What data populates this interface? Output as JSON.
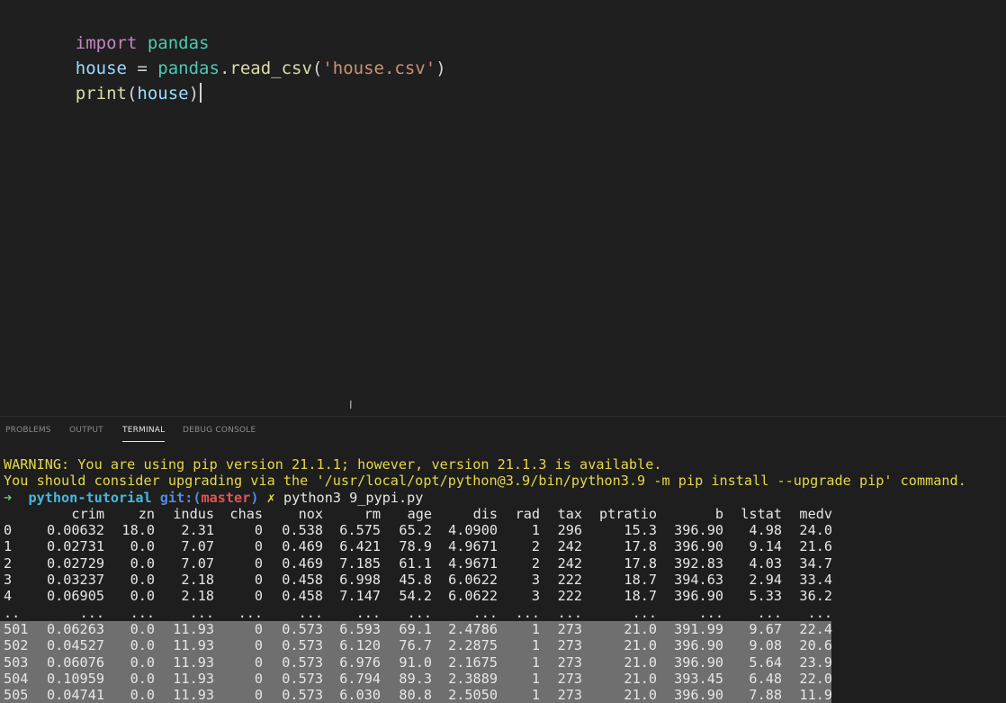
{
  "editor": {
    "line1": {
      "kw": "import",
      "mod": "pandas"
    },
    "line2": {
      "var": "house",
      "eq": " = ",
      "mod": "pandas",
      "dot": ".",
      "fn": "read_csv",
      "open": "(",
      "str": "'house.csv'",
      "close": ")"
    },
    "line3": {
      "fn": "print",
      "open": "(",
      "var": "house",
      "close": ")"
    }
  },
  "panel": {
    "tabs": [
      {
        "label": "PROBLEMS"
      },
      {
        "label": "OUTPUT"
      },
      {
        "label": "TERMINAL"
      },
      {
        "label": "DEBUG CONSOLE"
      }
    ],
    "active_tab": "TERMINAL"
  },
  "terminal": {
    "warning1": "WARNING: You are using pip version 21.1.1; however, version 21.1.3 is available.",
    "warning2": "You should consider upgrading via the '/usr/local/opt/python@3.9/bin/python3.9 -m pip install --upgrade pip' command.",
    "prompt": {
      "arrow": "➜",
      "dir": "python-tutorial",
      "git": "git:(",
      "branch": "master",
      "git_close": ")",
      "x": "✗",
      "command": "python3 9_pypi.py"
    },
    "columns": [
      "crim",
      "zn",
      "indus",
      "chas",
      "nox",
      "rm",
      "age",
      "dis",
      "rad",
      "tax",
      "ptratio",
      "b",
      "lstat",
      "medv"
    ],
    "rows": [
      {
        "idx": "0",
        "cells": [
          "0.00632",
          "18.0",
          "2.31",
          "0",
          "0.538",
          "6.575",
          "65.2",
          "4.0900",
          "1",
          "296",
          "15.3",
          "396.90",
          "4.98",
          "24.0"
        ],
        "selected": false
      },
      {
        "idx": "1",
        "cells": [
          "0.02731",
          "0.0",
          "7.07",
          "0",
          "0.469",
          "6.421",
          "78.9",
          "4.9671",
          "2",
          "242",
          "17.8",
          "396.90",
          "9.14",
          "21.6"
        ],
        "selected": false
      },
      {
        "idx": "2",
        "cells": [
          "0.02729",
          "0.0",
          "7.07",
          "0",
          "0.469",
          "7.185",
          "61.1",
          "4.9671",
          "2",
          "242",
          "17.8",
          "392.83",
          "4.03",
          "34.7"
        ],
        "selected": false
      },
      {
        "idx": "3",
        "cells": [
          "0.03237",
          "0.0",
          "2.18",
          "0",
          "0.458",
          "6.998",
          "45.8",
          "6.0622",
          "3",
          "222",
          "18.7",
          "394.63",
          "2.94",
          "33.4"
        ],
        "selected": false
      },
      {
        "idx": "4",
        "cells": [
          "0.06905",
          "0.0",
          "2.18",
          "0",
          "0.458",
          "7.147",
          "54.2",
          "6.0622",
          "3",
          "222",
          "18.7",
          "396.90",
          "5.33",
          "36.2"
        ],
        "selected": false
      },
      {
        "idx": "..",
        "cells": [
          "...",
          "...",
          "...",
          "...",
          "...",
          "...",
          "...",
          "...",
          "...",
          "...",
          "...",
          "...",
          "...",
          "..."
        ],
        "selected": false
      },
      {
        "idx": "501",
        "cells": [
          "0.06263",
          "0.0",
          "11.93",
          "0",
          "0.573",
          "6.593",
          "69.1",
          "2.4786",
          "1",
          "273",
          "21.0",
          "391.99",
          "9.67",
          "22.4"
        ],
        "selected": true
      },
      {
        "idx": "502",
        "cells": [
          "0.04527",
          "0.0",
          "11.93",
          "0",
          "0.573",
          "6.120",
          "76.7",
          "2.2875",
          "1",
          "273",
          "21.0",
          "396.90",
          "9.08",
          "20.6"
        ],
        "selected": true
      },
      {
        "idx": "503",
        "cells": [
          "0.06076",
          "0.0",
          "11.93",
          "0",
          "0.573",
          "6.976",
          "91.0",
          "2.1675",
          "1",
          "273",
          "21.0",
          "396.90",
          "5.64",
          "23.9"
        ],
        "selected": true
      },
      {
        "idx": "504",
        "cells": [
          "0.10959",
          "0.0",
          "11.93",
          "0",
          "0.573",
          "6.794",
          "89.3",
          "2.3889",
          "1",
          "273",
          "21.0",
          "393.45",
          "6.48",
          "22.0"
        ],
        "selected": true
      },
      {
        "idx": "505",
        "cells": [
          "0.04741",
          "0.0",
          "11.93",
          "0",
          "0.573",
          "6.030",
          "80.8",
          "2.5050",
          "1",
          "273",
          "21.0",
          "396.90",
          "7.88",
          "11.9"
        ],
        "selected": true
      }
    ]
  },
  "colors": {
    "editor_bg": "#1f1f1f",
    "keyword": "#c586c0",
    "module": "#4ec9b0",
    "string": "#ce9178",
    "function": "#dcdcaa",
    "variable": "#9cdcfe",
    "warning": "#e5d84a",
    "selection": "#6f6f6f"
  }
}
